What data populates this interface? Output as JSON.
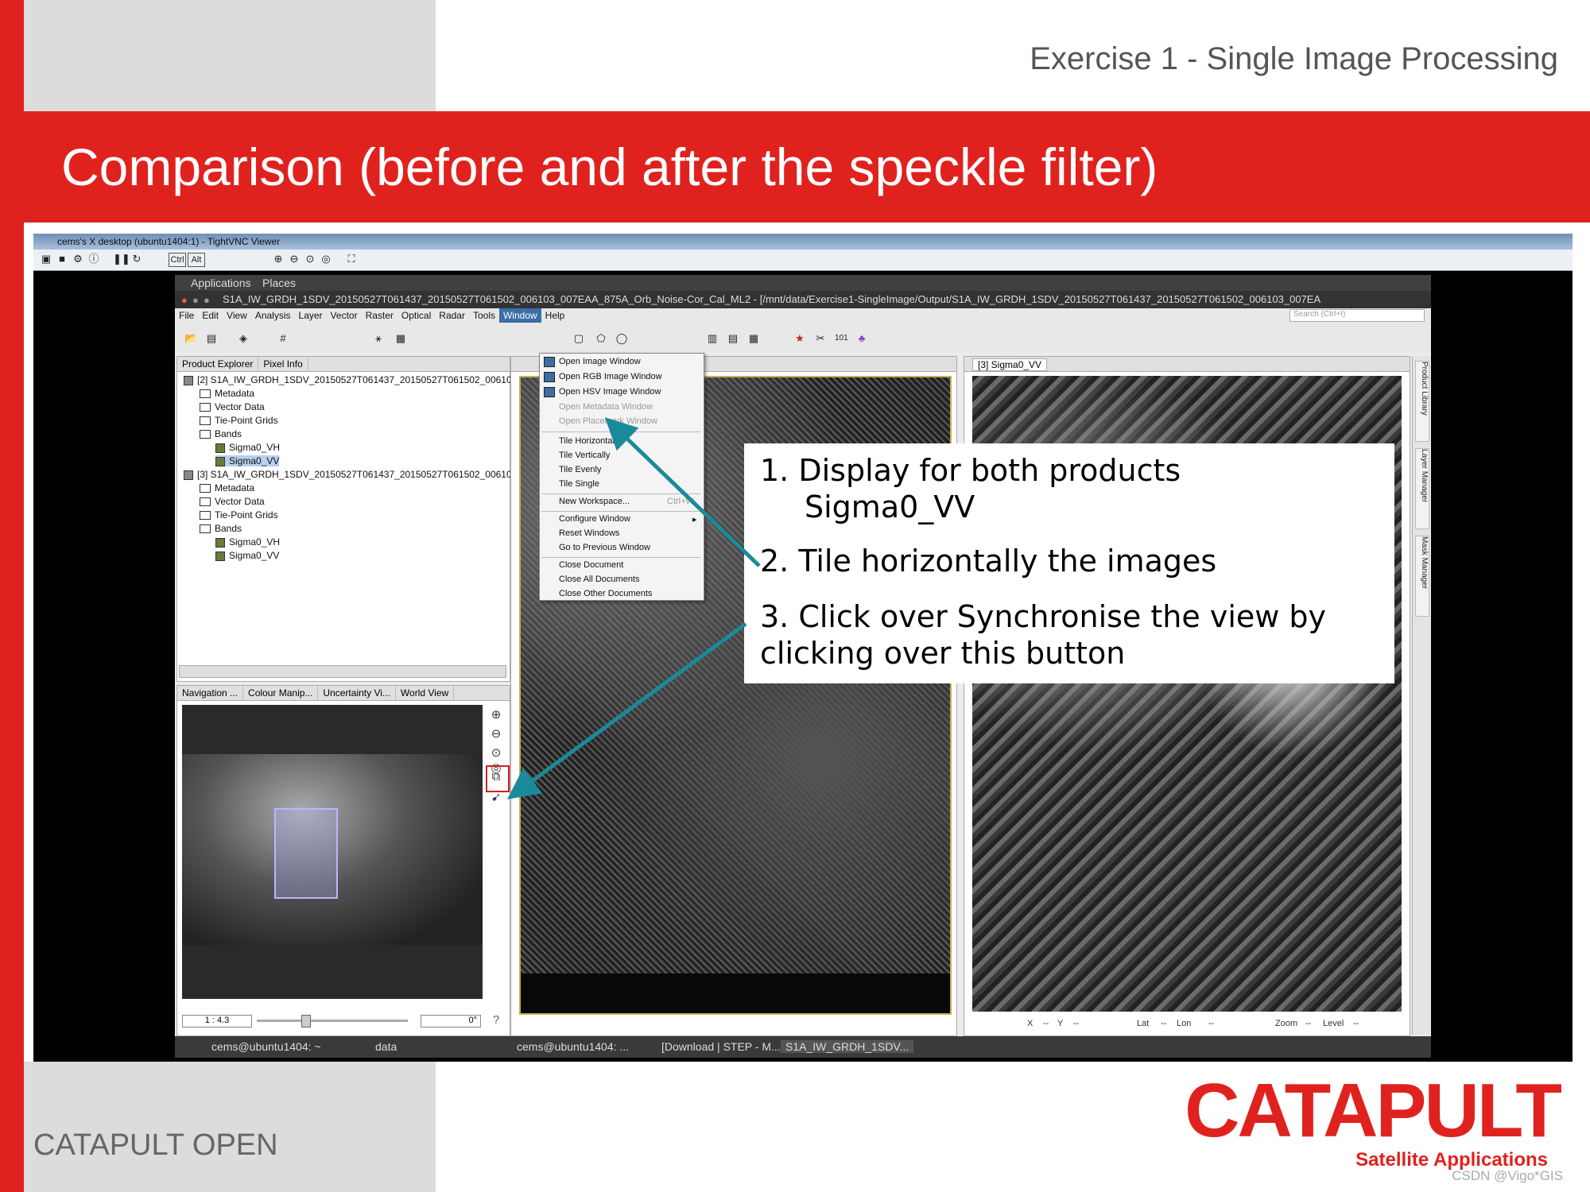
{
  "header": {
    "text": "Exercise 1 - Single Image Processing"
  },
  "slide": {
    "title": "Comparison (before and after the speckle filter)"
  },
  "footer": {
    "left": "CATAPULT OPEN",
    "watermark": "CSDN @Vigo*GIS"
  },
  "logo": {
    "word": "CATAPULT",
    "sub": "Satellite Applications"
  },
  "vnc": {
    "title": "cems's X desktop (ubuntu1404:1) - TightVNC Viewer",
    "ctrl": "Ctrl",
    "alt": "Alt"
  },
  "gnome": {
    "applications": "Applications",
    "places": "Places"
  },
  "snap": {
    "title": "S1A_IW_GRDH_1SDV_20150527T061437_20150527T061502_006103_007EAA_875A_Orb_Noise-Cor_Cal_ML2 - [/mnt/data/Exercise1-SingleImage/Output/S1A_IW_GRDH_1SDV_20150527T061437_20150527T061502_006103_007EA",
    "menu": [
      "File",
      "Edit",
      "View",
      "Analysis",
      "Layer",
      "Vector",
      "Raster",
      "Optical",
      "Radar",
      "Tools",
      "Window",
      "Help"
    ],
    "search_placeholder": "Search (Ctrl+I)"
  },
  "explorer": {
    "tabs": [
      "Product Explorer",
      "Pixel Info"
    ],
    "rows": [
      "[2] S1A_IW_GRDH_1SDV_20150527T061437_20150527T061502_00610",
      "Metadata",
      "Vector Data",
      "Tie-Point Grids",
      "Bands",
      "Sigma0_VH",
      "Sigma0_VV",
      "[3] S1A_IW_GRDH_1SDV_20150527T061437_20150527T061502_00610",
      "Metadata",
      "Vector Data",
      "Tie-Point Grids",
      "Bands",
      "Sigma0_VH",
      "Sigma0_VV"
    ]
  },
  "nav": {
    "tabs": [
      "Navigation ...",
      "Colour Manip...",
      "Uncertainty Vi...",
      "World View"
    ],
    "scale": "1 : 4.3",
    "angle": "0°"
  },
  "views": {
    "view2_tab": "[3] Sigma0_VV"
  },
  "sidebar": {
    "tabs": [
      "Product Library",
      "Layer Manager",
      "Mask Manager"
    ]
  },
  "status": {
    "x": "X",
    "x_val": "--",
    "y": "Y",
    "y_val": "--",
    "lat": "Lat",
    "lat_val": "--",
    "lon": "Lon",
    "lon_val": "--",
    "zoom": "Zoom",
    "zoom_val": "--",
    "level": "Level",
    "level_val": "--"
  },
  "window_menu": [
    {
      "label": "Open Image Window",
      "disabled": false
    },
    {
      "label": "Open RGB Image Window",
      "disabled": false
    },
    {
      "label": "Open HSV Image Window",
      "disabled": false
    },
    {
      "label": "Open Metadata Window",
      "disabled": true
    },
    {
      "label": "Open Placemark Window",
      "disabled": true
    },
    {
      "label": "Tile Horizontally",
      "disabled": false
    },
    {
      "label": "Tile Vertically",
      "disabled": false
    },
    {
      "label": "Tile Evenly",
      "disabled": false
    },
    {
      "label": "Tile Single",
      "disabled": false
    },
    {
      "label": "New Workspace...",
      "disabled": false
    },
    {
      "label": "Configure Window",
      "disabled": false
    },
    {
      "label": "Reset Windows",
      "disabled": false
    },
    {
      "label": "Go to Previous Window",
      "disabled": false
    },
    {
      "label": "Close Document",
      "disabled": false
    },
    {
      "label": "Close All Documents",
      "disabled": false
    },
    {
      "label": "Close Other Documents",
      "disabled": false
    }
  ],
  "window_menu_shortcut": "Ctrl+W",
  "taskbar": [
    "cems@ubuntu1404: ~",
    "data",
    "cems@ubuntu1404: ...",
    "[Download | STEP - M...",
    "S1A_IW_GRDH_1SDV..."
  ],
  "callout": {
    "line1": "1. Display for both products",
    "line1b": "Sigma0_VV",
    "line2": "2. Tile horizontally the images",
    "line3": "3. Click over Synchronise the view by",
    "line3b": "clicking over  this button"
  },
  "colors": {
    "brand": "#e0221f",
    "arrow": "#1a8a9a"
  }
}
